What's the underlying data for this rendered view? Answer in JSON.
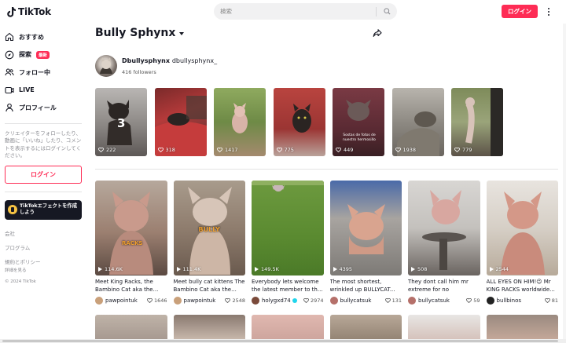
{
  "header": {
    "logo_text": "TikTok",
    "search_placeholder": "検索",
    "login_label": "ログイン",
    "accent_color": "#fe2c55"
  },
  "sidebar": {
    "items": [
      {
        "label": "おすすめ",
        "icon": "home-icon"
      },
      {
        "label": "探索",
        "icon": "compass-icon",
        "badge": "最新"
      },
      {
        "label": "フォロー中",
        "icon": "people-icon"
      },
      {
        "label": "LIVE",
        "icon": "live-icon"
      },
      {
        "label": "プロフィール",
        "icon": "user-icon"
      }
    ],
    "note": "クリエイターをフォローしたり、動画に「いいね」したり、コメントを表示するにはログインしてください。",
    "login_label": "ログイン",
    "effect_label": "TikTokエフェクトを作成しよう",
    "links": [
      "会社",
      "プログラム",
      "規約とポリシー"
    ],
    "more_label": "詳細を見る",
    "copyright": "© 2024 TikTok"
  },
  "main": {
    "title": "Bully Sphynx",
    "account": {
      "name": "Dbullysphynx",
      "handle": "dbullysphynx_",
      "followers": "416 followers"
    },
    "pinned": [
      {
        "views": "222",
        "overlay": "3"
      },
      {
        "views": "318"
      },
      {
        "views": "1417"
      },
      {
        "views": "775"
      },
      {
        "views": "449",
        "overlay_text": "Sostas de fotos de nuestro hermosillo"
      },
      {
        "views": "1938"
      },
      {
        "views": "779"
      }
    ],
    "videos": [
      {
        "views": "114.6K",
        "desc": "Meet King Racks, the Bambino Cat aka the...",
        "user": "pawpointuk",
        "likes": "1646",
        "overlay_text": "RACKS"
      },
      {
        "views": "111.4K",
        "desc": "Meet bully cat kittens The Bambino Cat aka the...",
        "user": "pawpointuk",
        "likes": "2548",
        "overlay_text": "BULLY"
      },
      {
        "views": "149.5K",
        "desc": "Everybody lets welcome the latest member to th...",
        "user": "holygxd74",
        "likes": "2974",
        "verified": true
      },
      {
        "views": "4395",
        "desc": "The most shortest, wrinkled up BULLYCAT...",
        "user": "bullycatsuk",
        "likes": "131"
      },
      {
        "views": "508",
        "desc": "They dont call him mr extreme for no reason.......",
        "user": "bullycatsuk",
        "likes": "59"
      },
      {
        "views": "2544",
        "desc": "ALL EYES ON HIM!😉 Mr KING RACKS worldwide...",
        "user": "bullbinos",
        "likes": "81"
      }
    ]
  }
}
